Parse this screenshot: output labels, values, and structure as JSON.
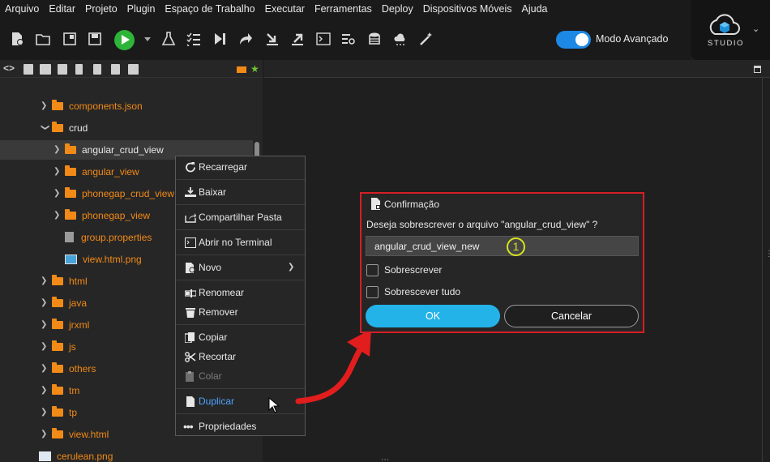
{
  "menubar": [
    "Arquivo",
    "Editar",
    "Projeto",
    "Plugin",
    "Espaço de Trabalho",
    "Executar",
    "Ferramentas",
    "Deploy",
    "Dispositivos Móveis",
    "Ajuda"
  ],
  "toolbar": {
    "icons": [
      "new-file-icon",
      "open-folder-icon",
      "window-icon",
      "save-icon",
      "run-icon",
      "test-flask-icon",
      "checklist-icon",
      "step-forward-icon",
      "redo-icon",
      "deploy-down-icon",
      "export-icon",
      "terminal-icon",
      "search-list-icon",
      "database-icon",
      "cloud-icon",
      "magic-wand-icon"
    ],
    "mode_label": "Modo Avançado",
    "mode_on": true
  },
  "brand": {
    "label": "STUDIO"
  },
  "tree": [
    {
      "label": "components.json",
      "kind": "folder",
      "color": "orange"
    },
    {
      "label": "crud",
      "kind": "folder",
      "color": "white",
      "expanded": true
    },
    {
      "label": "angular_crud_view",
      "kind": "folder",
      "color": "white",
      "selected": true
    },
    {
      "label": "angular_view",
      "kind": "folder",
      "color": "orange"
    },
    {
      "label": "phonegap_crud_view",
      "kind": "folder",
      "color": "orange"
    },
    {
      "label": "phonegap_view",
      "kind": "folder",
      "color": "orange"
    },
    {
      "label": "group.properties",
      "kind": "file",
      "color": "orange"
    },
    {
      "label": "view.html.png",
      "kind": "image",
      "color": "orange"
    },
    {
      "label": "html",
      "kind": "folder",
      "color": "orange"
    },
    {
      "label": "java",
      "kind": "folder",
      "color": "orange"
    },
    {
      "label": "jrxml",
      "kind": "folder",
      "color": "orange"
    },
    {
      "label": "js",
      "kind": "folder",
      "color": "orange"
    },
    {
      "label": "others",
      "kind": "folder",
      "color": "orange"
    },
    {
      "label": "tm",
      "kind": "folder",
      "color": "orange"
    },
    {
      "label": "tp",
      "kind": "folder",
      "color": "orange"
    },
    {
      "label": "view.html",
      "kind": "folder",
      "color": "orange"
    },
    {
      "label": "cerulean.png",
      "kind": "image",
      "color": "orange"
    }
  ],
  "context_menu": [
    {
      "label": "Recarregar",
      "icon": "reload-icon"
    },
    {
      "label": "Baixar",
      "icon": "download-icon"
    },
    {
      "label": "Compartilhar Pasta",
      "icon": "share-icon"
    },
    {
      "label": "Abrir no Terminal",
      "icon": "terminal-icon"
    },
    {
      "label": "Novo",
      "icon": "new-icon",
      "submenu": true
    },
    {
      "label": "Renomear",
      "icon": "rename-icon"
    },
    {
      "label": "Remover",
      "icon": "trash-icon"
    },
    {
      "label": "Copiar",
      "icon": "copy-icon"
    },
    {
      "label": "Recortar",
      "icon": "scissors-icon"
    },
    {
      "label": "Colar",
      "icon": "paste-icon",
      "disabled": true
    },
    {
      "label": "Duplicar",
      "icon": "duplicate-icon",
      "highlighted": true
    },
    {
      "label": "Propriedades",
      "icon": "more-icon"
    }
  ],
  "dialog": {
    "title": "Confirmação",
    "message": "Deseja sobrescrever o arquivo \"angular_crud_view\" ?",
    "input_value": "angular_crud_view_new",
    "annotation": "1",
    "checkbox_overwrite": "Sobrescrever",
    "checkbox_overwrite_all": "Sobrescever tudo",
    "ok_label": "OK",
    "cancel_label": "Cancelar"
  },
  "colors": {
    "accent": "#23b3e8",
    "folder": "#f28a17",
    "highlight_border": "#d41f26",
    "arrow": "#e11d1d",
    "run": "#2fb43a"
  }
}
